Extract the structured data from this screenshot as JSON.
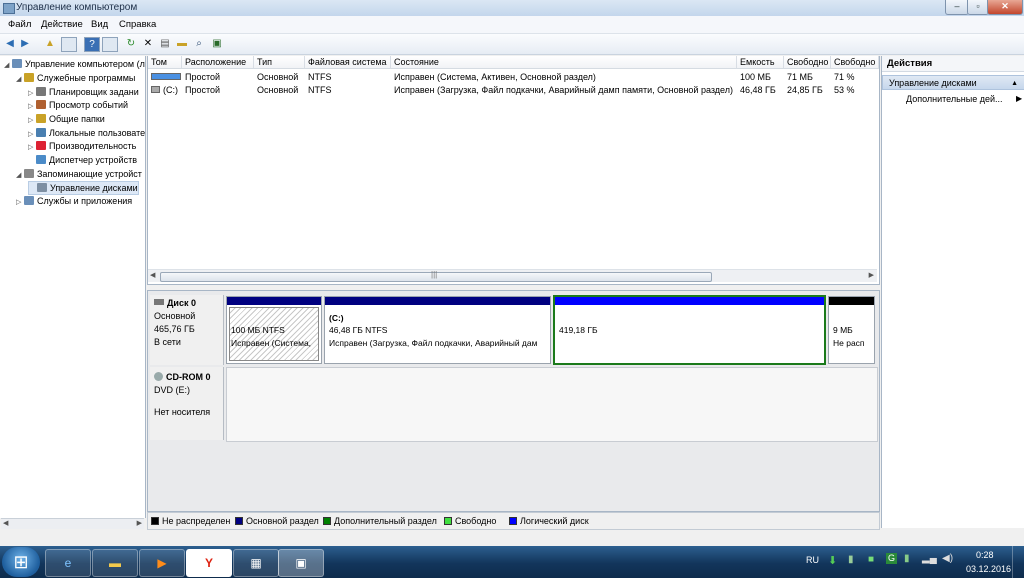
{
  "window": {
    "title": "Управление компьютером"
  },
  "menu": [
    "Файл",
    "Действие",
    "Вид",
    "Справка"
  ],
  "tree": [
    {
      "label": "Управление компьютером (л",
      "level": 0
    },
    {
      "label": "Служебные программы",
      "level": 1
    },
    {
      "label": "Планировщик задани",
      "level": 2
    },
    {
      "label": "Просмотр событий",
      "level": 2
    },
    {
      "label": "Общие папки",
      "level": 2
    },
    {
      "label": "Локальные пользовате",
      "level": 2
    },
    {
      "label": "Производительность",
      "level": 2
    },
    {
      "label": "Диспетчер устройств",
      "level": 2
    },
    {
      "label": "Запоминающие устройст",
      "level": 1
    },
    {
      "label": "Управление дисками",
      "level": 2
    },
    {
      "label": "Службы и приложения",
      "level": 1
    }
  ],
  "columns": [
    "Том",
    "Расположение",
    "Тип",
    "Файловая система",
    "Состояние",
    "Емкость",
    "Свободно",
    "Свободно"
  ],
  "rows": [
    [
      "",
      "Простой",
      "Основной",
      "NTFS",
      "Исправен (Система, Активен, Основной раздел)",
      "100 МБ",
      "71 МБ",
      "71 %"
    ],
    [
      "(C:)",
      "Простой",
      "Основной",
      "NTFS",
      "Исправен (Загрузка, Файл подкачки, Аварийный дамп памяти, Основной раздел)",
      "46,48 ГБ",
      "24,85 ГБ",
      "53 %"
    ]
  ],
  "disks": [
    {
      "name": "Диск 0",
      "type": "Основной",
      "size": "465,76 ГБ",
      "status": "В сети",
      "partitions": [
        {
          "title": "",
          "size": "100 МБ NTFS",
          "status": "Исправен (Система,",
          "kind": "primary"
        },
        {
          "title": "(C:)",
          "size": "46,48 ГБ NTFS",
          "status": "Исправен (Загрузка, Файл подкачки, Аварийный дам",
          "kind": "primary"
        },
        {
          "title": "",
          "size": "419,18 ГБ",
          "status": "",
          "kind": "logical"
        },
        {
          "title": "",
          "size": "9 МБ",
          "status": "Не расп",
          "kind": "unallocated"
        }
      ]
    },
    {
      "name": "CD-ROM 0",
      "type": "DVD (E:)",
      "size": "",
      "status": "Нет носителя",
      "partitions": []
    }
  ],
  "legend": [
    {
      "label": "Не распределен",
      "color": "#000000"
    },
    {
      "label": "Основной раздел",
      "color": "#000080"
    },
    {
      "label": "Дополнительный раздел",
      "color": "#008000"
    },
    {
      "label": "Свободно",
      "color": "#40e040"
    },
    {
      "label": "Логический диск",
      "color": "#0000ff"
    }
  ],
  "actions": {
    "header": "Действия",
    "section": "Управление дисками",
    "more": "Дополнительные дей..."
  },
  "tray": {
    "lang": "RU",
    "time": "0:28",
    "date": "03.12.2016"
  }
}
